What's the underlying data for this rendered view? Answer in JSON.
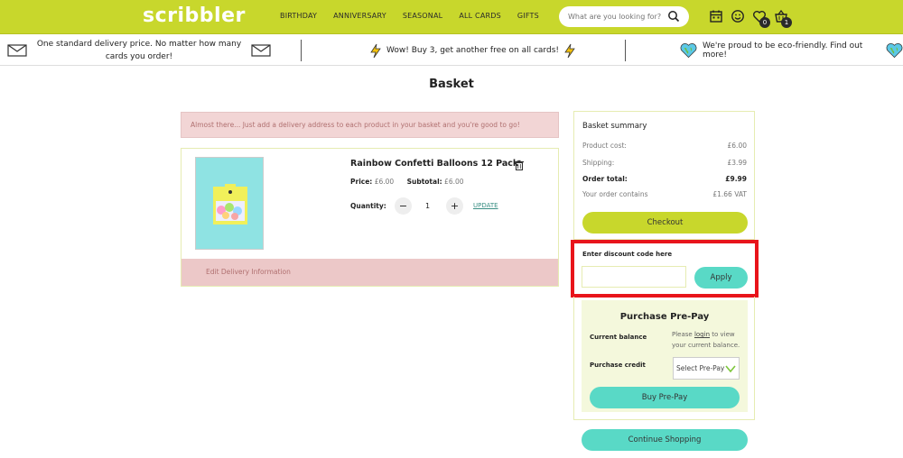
{
  "header": {
    "logo": "scribbler",
    "nav": [
      "BIRTHDAY",
      "ANNIVERSARY",
      "SEASONAL",
      "ALL CARDS",
      "GIFTS"
    ],
    "search_placeholder": "What are you looking for?",
    "wishlist_count": "0",
    "basket_count": "1"
  },
  "promo": {
    "delivery": "One standard delivery price. No matter how many cards you order!",
    "offer": "Wow! Buy 3, get another free on all cards!",
    "eco": "We're proud to be eco-friendly. Find out more!"
  },
  "page_title": "Basket",
  "alert": "Almost there... Just add a delivery address to each product in your basket and you're good to go!",
  "item": {
    "name": "Rainbow Confetti Balloons 12 Pack",
    "price_label": "Price:",
    "price": "£6.00",
    "subtotal_label": "Subtotal:",
    "subtotal": "£6.00",
    "quantity_label": "Quantity:",
    "quantity": "1",
    "minus": "−",
    "plus": "+",
    "update": "UPDATE",
    "delivery_link": "Edit Delivery Information"
  },
  "summary": {
    "title": "Basket summary",
    "rows": [
      {
        "label": "Product cost:",
        "value": "£6.00"
      },
      {
        "label": "Shipping:",
        "value": "£3.99"
      },
      {
        "label": "Order total:",
        "value": "£9.99"
      },
      {
        "label": "Your order contains",
        "value": "£1.66 VAT"
      }
    ],
    "checkout": "Checkout"
  },
  "discount": {
    "label": "Enter discount code here",
    "value": "",
    "apply": "Apply"
  },
  "prepay": {
    "title": "Purchase Pre-Pay",
    "balance_label": "Current balance",
    "note_before": "Please ",
    "note_link": "login",
    "note_after": " to view your current balance.",
    "credit_label": "Purchase credit",
    "select_value": "Select Pre-Pay",
    "buy": "Buy Pre-Pay"
  },
  "continue": "Continue Shopping",
  "colors": {
    "brand": "#c8d72c",
    "accent": "#59d9c6",
    "highlight": "#e8141b"
  }
}
